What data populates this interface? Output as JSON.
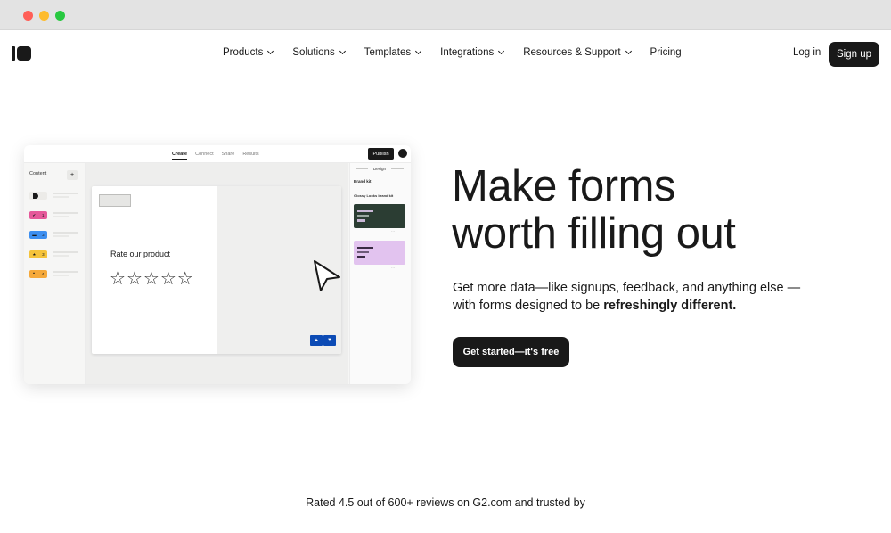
{
  "nav": {
    "items": [
      {
        "label": "Products",
        "has_dropdown": true
      },
      {
        "label": "Solutions",
        "has_dropdown": true
      },
      {
        "label": "Templates",
        "has_dropdown": true
      },
      {
        "label": "Integrations",
        "has_dropdown": true
      },
      {
        "label": "Resources & Support",
        "has_dropdown": true
      },
      {
        "label": "Pricing",
        "has_dropdown": false
      }
    ],
    "login_label": "Log in",
    "signup_label": "Sign up"
  },
  "mockup": {
    "tabs": [
      "Create",
      "Connect",
      "Share",
      "Results"
    ],
    "active_tab": "Create",
    "publish_label": "Publish",
    "sidebar": {
      "content_label": "Content",
      "add_label": "+",
      "questions": [
        {
          "icon": "welcome-icon",
          "number": "",
          "color": "#ecebe8"
        },
        {
          "icon": "check-icon",
          "number": "1",
          "color": "#e5589a"
        },
        {
          "icon": "short-text-icon",
          "number": "2",
          "color": "#3d8ff0"
        },
        {
          "icon": "star-icon",
          "number": "3",
          "color": "#f5c33b"
        },
        {
          "icon": "quote-icon",
          "number": "4",
          "color": "#f5a93b"
        }
      ]
    },
    "question_text": "Rate our product",
    "star_count": 5,
    "right_panel": {
      "tab_label": "Design",
      "brand_kit_label": "Brand kit",
      "kit_name": "Glossy Looks brand kit",
      "themes": [
        {
          "bg": "#2b3d33",
          "accent": "#c9b8d6"
        },
        {
          "bg": "#e2c3ef",
          "accent": "#3a2b44"
        }
      ]
    }
  },
  "hero": {
    "headline_line1": "Make forms",
    "headline_line2": "worth filling out",
    "subtitle_plain": "Get more data—like signups, feedback, and anything else —with forms designed to be ",
    "subtitle_bold": "refreshingly different.",
    "cta_label": "Get started—it's free"
  },
  "rating_text": "Rated 4.5 out of 600+ reviews on G2.com and trusted by"
}
